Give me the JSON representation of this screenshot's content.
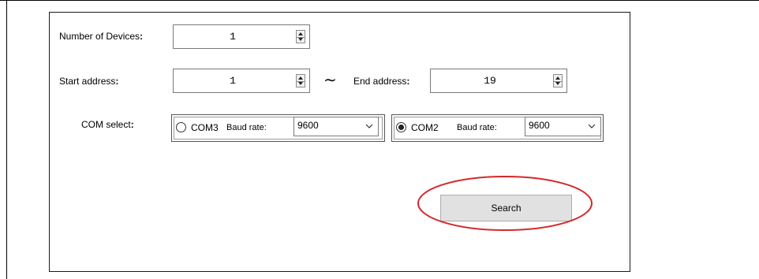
{
  "form": {
    "devices_label": "Number of Devices",
    "devices_colon": ":",
    "devices_value": "1",
    "start_label": "Start address",
    "start_colon": ":",
    "start_value": "1",
    "range_symbol": "∼",
    "end_label": "End address",
    "end_colon": ":",
    "end_value": "19",
    "com_label": "COM select",
    "com_colon": ":"
  },
  "com_ports": [
    {
      "name": "COM3",
      "selected": false,
      "baud_label": "Baud rate:",
      "baud_value": "9600"
    },
    {
      "name": "COM2",
      "selected": true,
      "baud_label": "Baud rate:",
      "baud_value": "9600"
    }
  ],
  "search_label": "Search",
  "colors": {
    "highlight": "#d42a2a",
    "button_bg": "#e1e1e1"
  }
}
